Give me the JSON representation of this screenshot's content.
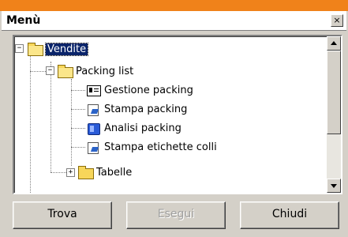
{
  "window": {
    "title": "Menù",
    "close_label": "×"
  },
  "tree": {
    "root": {
      "label": "Vendite",
      "expander": "−",
      "selected": true
    },
    "packing_list": {
      "label": "Packing list",
      "expander": "−"
    },
    "items": [
      {
        "label": "Gestione packing",
        "icon": "grid-document-icon"
      },
      {
        "label": "Stampa packing",
        "icon": "print-report-icon"
      },
      {
        "label": "Analisi packing",
        "icon": "analysis-cube-icon"
      },
      {
        "label": "Stampa etichette colli",
        "icon": "print-report-icon"
      }
    ],
    "tabelle": {
      "label": "Tabelle",
      "expander": "+"
    }
  },
  "buttons": {
    "trova": {
      "label": "Trova"
    },
    "esegui": {
      "label": "Esegui",
      "disabled": true
    },
    "chiudi": {
      "label": "Chiudi"
    }
  }
}
